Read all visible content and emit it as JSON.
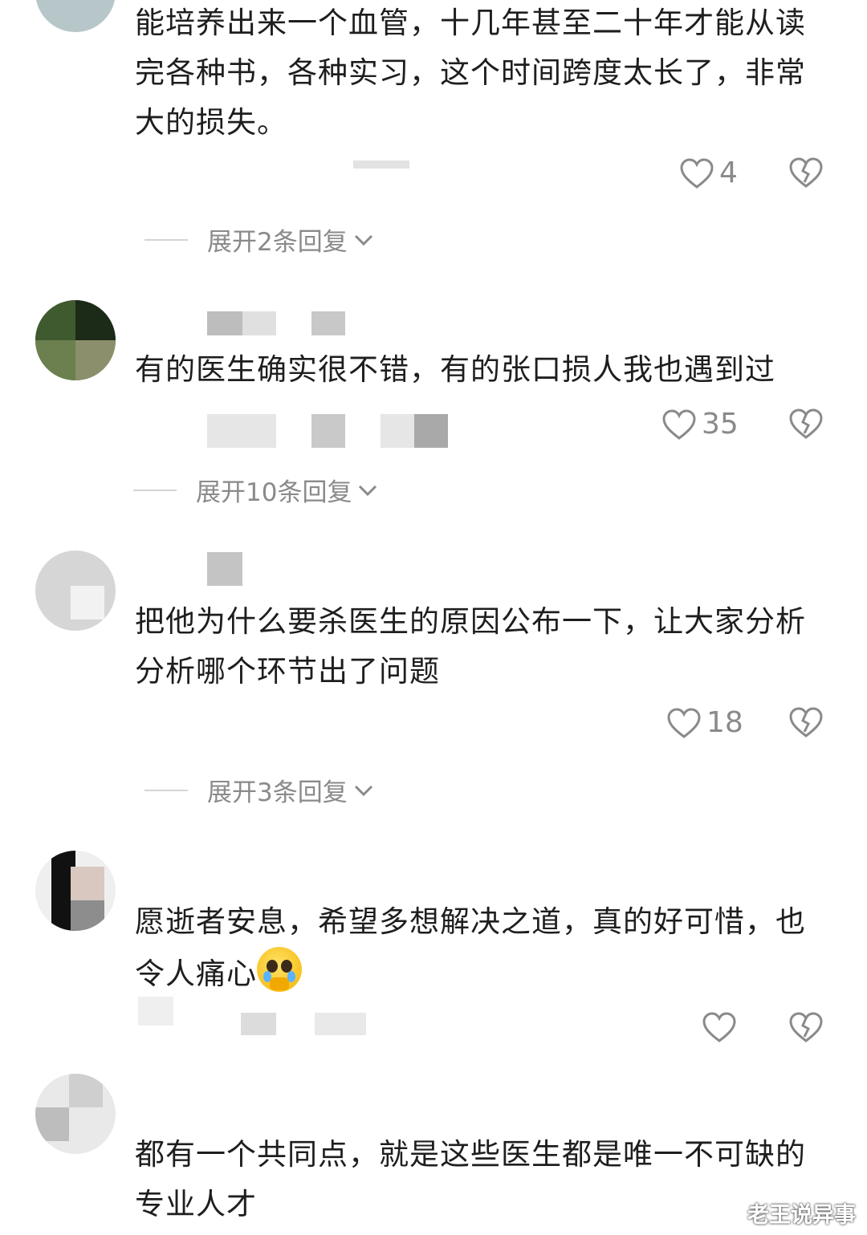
{
  "comments": [
    {
      "text": "能培养出来一个血管，十几年甚至二十年才能从读完各种书，各种实习，这个时间跨度太长了，非常大的损失。",
      "likes": "4",
      "expand": "展开2条回复"
    },
    {
      "text": "有的医生确实很不错，有的张口损人我也遇到过",
      "likes": "35",
      "expand": "展开10条回复"
    },
    {
      "text": "把他为什么要杀医生的原因公布一下，让大家分析分析哪个环节出了问题",
      "likes": "18",
      "expand": "展开3条回复"
    },
    {
      "text": "愿逝者安息，希望多想解决之道，真的好可惜，也令人痛心",
      "likes": "",
      "emoji": "crying-pleading-emoji"
    },
    {
      "text": "都有一个共同点，就是这些医生都是唯一不可缺的专业人才"
    }
  ],
  "watermark": "老王说异事",
  "icons": {
    "like": "heart-outline-icon",
    "dislike": "broken-heart-icon",
    "expand": "chevron-down-icon"
  },
  "colors": {
    "text": "#1e1e1e",
    "meta": "#8a8a8a",
    "background": "#ffffff"
  }
}
